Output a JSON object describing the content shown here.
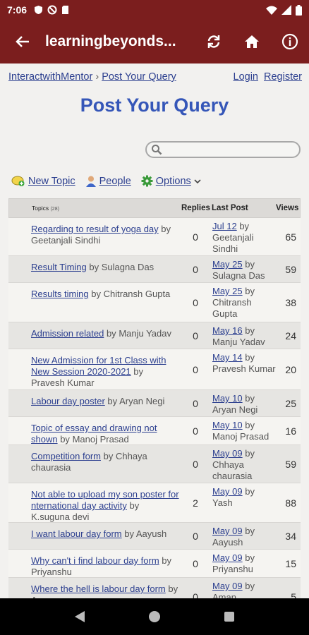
{
  "status": {
    "time": "7:06",
    "left_icons": [
      "shield-icon",
      "no-sim-icon",
      "sd-card-icon"
    ],
    "right_icons": [
      "wifi-icon",
      "signal-icon",
      "battery-icon"
    ]
  },
  "appbar": {
    "title": "learningbeyonds...",
    "actions": [
      "refresh-icon",
      "home-icon",
      "info-icon"
    ]
  },
  "breadcrumb": {
    "root": "InteractwithMentor",
    "sep": "›",
    "current": "Post Your Query"
  },
  "toplinks": {
    "login": "Login",
    "register": "Register"
  },
  "page_title": "Post Your Query",
  "search": {
    "placeholder": "",
    "value": ""
  },
  "toolbar": {
    "new_topic": "New Topic",
    "people": "People",
    "options": "Options"
  },
  "table": {
    "headers": {
      "topics": "Topics",
      "topics_count": "(28)",
      "replies": "Replies",
      "last_post": "Last Post",
      "views": "Views"
    },
    "rows": [
      {
        "title": "Regarding to result of yoga day",
        "author": "Geetanjali Sindhi",
        "replies": "0",
        "date": "Jul 12",
        "last_by": "Geetanjali Sindhi",
        "views": "65"
      },
      {
        "title": "Result Timing",
        "author": "Sulagna Das",
        "replies": "0",
        "date": "May 25",
        "last_by": "Sulagna Das",
        "views": "59"
      },
      {
        "title": "Results timing",
        "author": "Chitransh Gupta",
        "replies": "0",
        "date": "May 25",
        "last_by": "Chitransh Gupta",
        "views": "38"
      },
      {
        "title": "Admission related",
        "author": "Manju Yadav",
        "replies": "0",
        "date": "May 16",
        "last_by": "Manju Yadav",
        "views": "24"
      },
      {
        "title": "New Admission for 1st Class with New Session 2020-2021",
        "author": "Pravesh Kumar",
        "replies": "0",
        "date": "May 14",
        "last_by": "Pravesh Kumar",
        "views": "20"
      },
      {
        "title": "Labour day poster",
        "author": "Aryan Negi",
        "replies": "0",
        "date": "May 10",
        "last_by": "Aryan Negi",
        "views": "25"
      },
      {
        "title": "Topic of essay and drawing not shown",
        "author": "Manoj Prasad",
        "replies": "0",
        "date": "May 10",
        "last_by": "Manoj Prasad",
        "views": "16"
      },
      {
        "title": "Competition form",
        "author": "Chhaya chaurasia",
        "replies": "0",
        "date": "May 09",
        "last_by": "Chhaya chaurasia",
        "views": "59"
      },
      {
        "title": "Not able to upload my son poster for nternational day activity",
        "author": "K.suguna devi",
        "replies": "2",
        "date": "May 09",
        "last_by": "Yash",
        "views": "88"
      },
      {
        "title": "I want labour day form",
        "author": "Aayush",
        "replies": "0",
        "date": "May 09",
        "last_by": "Aayush",
        "views": "34"
      },
      {
        "title": "Why can't i find labour day form",
        "author": "Priyanshu",
        "replies": "0",
        "date": "May 09",
        "last_by": "Priyanshu",
        "views": "15"
      },
      {
        "title": "Where the hell is labour day form",
        "author": "Aman",
        "replies": "0",
        "date": "May 09",
        "last_by": "Aman",
        "views": "5"
      }
    ]
  },
  "by_word": "by",
  "navbar": [
    "back-triangle-icon",
    "home-circle-icon",
    "recents-square-icon"
  ]
}
